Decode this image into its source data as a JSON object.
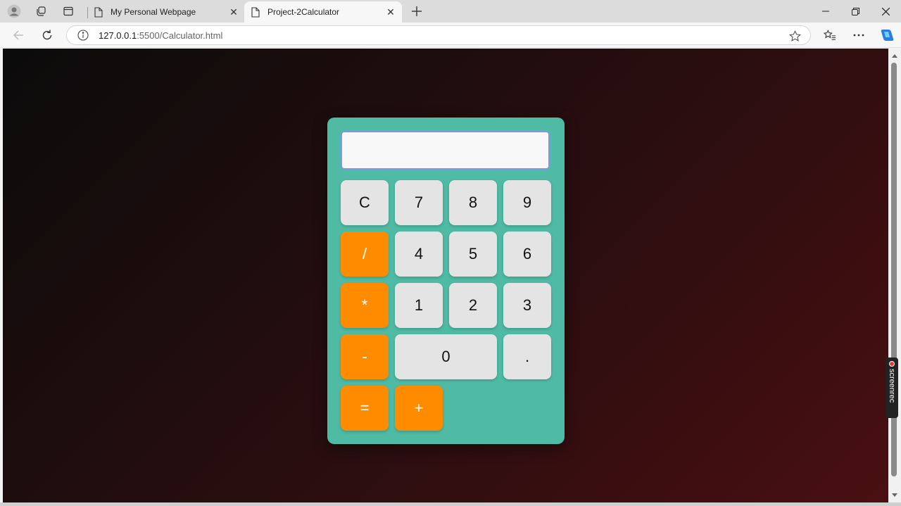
{
  "browser": {
    "tabs": [
      {
        "title": "My Personal Webpage",
        "active": false
      },
      {
        "title": "Project-2Calculator",
        "active": true
      }
    ],
    "url_host": "127.0.0.1",
    "url_path": ":5500/Calculator.html"
  },
  "calculator": {
    "display_value": "",
    "keys": {
      "clear": "C",
      "k7": "7",
      "k8": "8",
      "k9": "9",
      "divide": "/",
      "k4": "4",
      "k5": "5",
      "k6": "6",
      "multiply": "*",
      "k1": "1",
      "k2": "2",
      "k3": "3",
      "subtract": "-",
      "k0": "0",
      "decimal": ".",
      "equals": "=",
      "add": "+"
    }
  },
  "overlay": {
    "recorder_label": "screenrec"
  },
  "colors": {
    "calc_body": "#4fbba5",
    "operator_key": "#ff8c00",
    "number_key": "#e4e4e4",
    "page_background_start": "#0b0b0b",
    "page_background_end": "#4a0f11"
  }
}
